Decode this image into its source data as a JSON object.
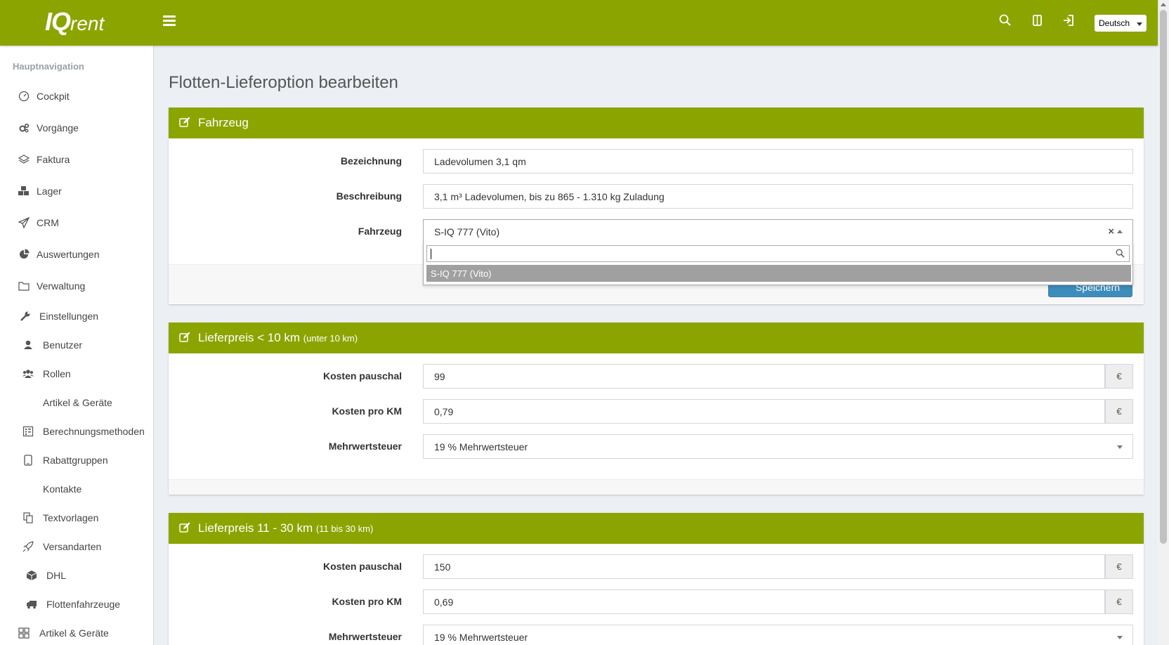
{
  "app": {
    "logo_iq": "IQ",
    "logo_rent": "rent",
    "language": "Deutsch"
  },
  "sidebar": {
    "header": "Hauptnavigation",
    "items": [
      {
        "label": "Cockpit",
        "icon": "gauge-icon"
      },
      {
        "label": "Vorgänge",
        "icon": "cogs-icon"
      },
      {
        "label": "Faktura",
        "icon": "layers-icon"
      },
      {
        "label": "Lager",
        "icon": "cubes-icon"
      },
      {
        "label": "CRM",
        "icon": "paper-plane-icon"
      },
      {
        "label": "Auswertungen",
        "icon": "pie-chart-icon"
      },
      {
        "label": "Verwaltung",
        "icon": "folder-icon"
      },
      {
        "label": "Einstellungen",
        "icon": "wrench-icon"
      },
      {
        "label": "Benutzer",
        "icon": "user-icon"
      },
      {
        "label": "Rollen",
        "icon": "users-icon"
      },
      {
        "label": "Artikel & Geräte",
        "icon": ""
      },
      {
        "label": "Berechnungsmethoden",
        "icon": "calculator-icon"
      },
      {
        "label": "Rabattgruppen",
        "icon": "tablet-icon"
      },
      {
        "label": "Kontakte",
        "icon": ""
      },
      {
        "label": "Textvorlagen",
        "icon": "copy-icon"
      },
      {
        "label": "Versandarten",
        "icon": "rocket-icon"
      },
      {
        "label": "DHL",
        "icon": "cube-icon"
      },
      {
        "label": "Flottenfahrzeuge",
        "icon": "truck-icon"
      },
      {
        "label": "Artikel & Geräte",
        "icon": "grid-icon"
      }
    ]
  },
  "page": {
    "title": "Flotten-Lieferoption bearbeiten"
  },
  "fahrzeug_card": {
    "title": "Fahrzeug",
    "fields": [
      {
        "label": "Bezeichnung",
        "value": "Ladevolumen 3,1 qm"
      },
      {
        "label": "Beschreibung",
        "value": "3,1 m³ Ladevolumen, bis zu 865 - 1.310 kg Zuladung"
      },
      {
        "label": "Fahrzeug",
        "value": "S-IQ 777 (Vito)"
      }
    ],
    "dropdown_option": "S-IQ 777 (Vito)",
    "save_label": "Speichern"
  },
  "lieferpreis1": {
    "title": "Lieferpreis < 10 km",
    "subtitle": "(unter 10 km)",
    "fields": [
      {
        "label": "Kosten pauschal",
        "value": "99",
        "addon": "€"
      },
      {
        "label": "Kosten pro KM",
        "value": "0,79",
        "addon": "€"
      },
      {
        "label": "Mehrwertsteuer",
        "value": "19 % Mehrwertsteuer"
      }
    ]
  },
  "lieferpreis2": {
    "title": "Lieferpreis 11 - 30 km",
    "subtitle": "(11 bis 30 km)",
    "fields": [
      {
        "label": "Kosten pauschal",
        "value": "150",
        "addon": "€"
      },
      {
        "label": "Kosten pro KM",
        "value": "0,69",
        "addon": "€"
      },
      {
        "label": "Mehrwertsteuer",
        "value": "19 % Mehrwertsteuer"
      }
    ]
  },
  "colors": {
    "brand": "#8ca400",
    "primary_button": "#3c8dbc"
  }
}
